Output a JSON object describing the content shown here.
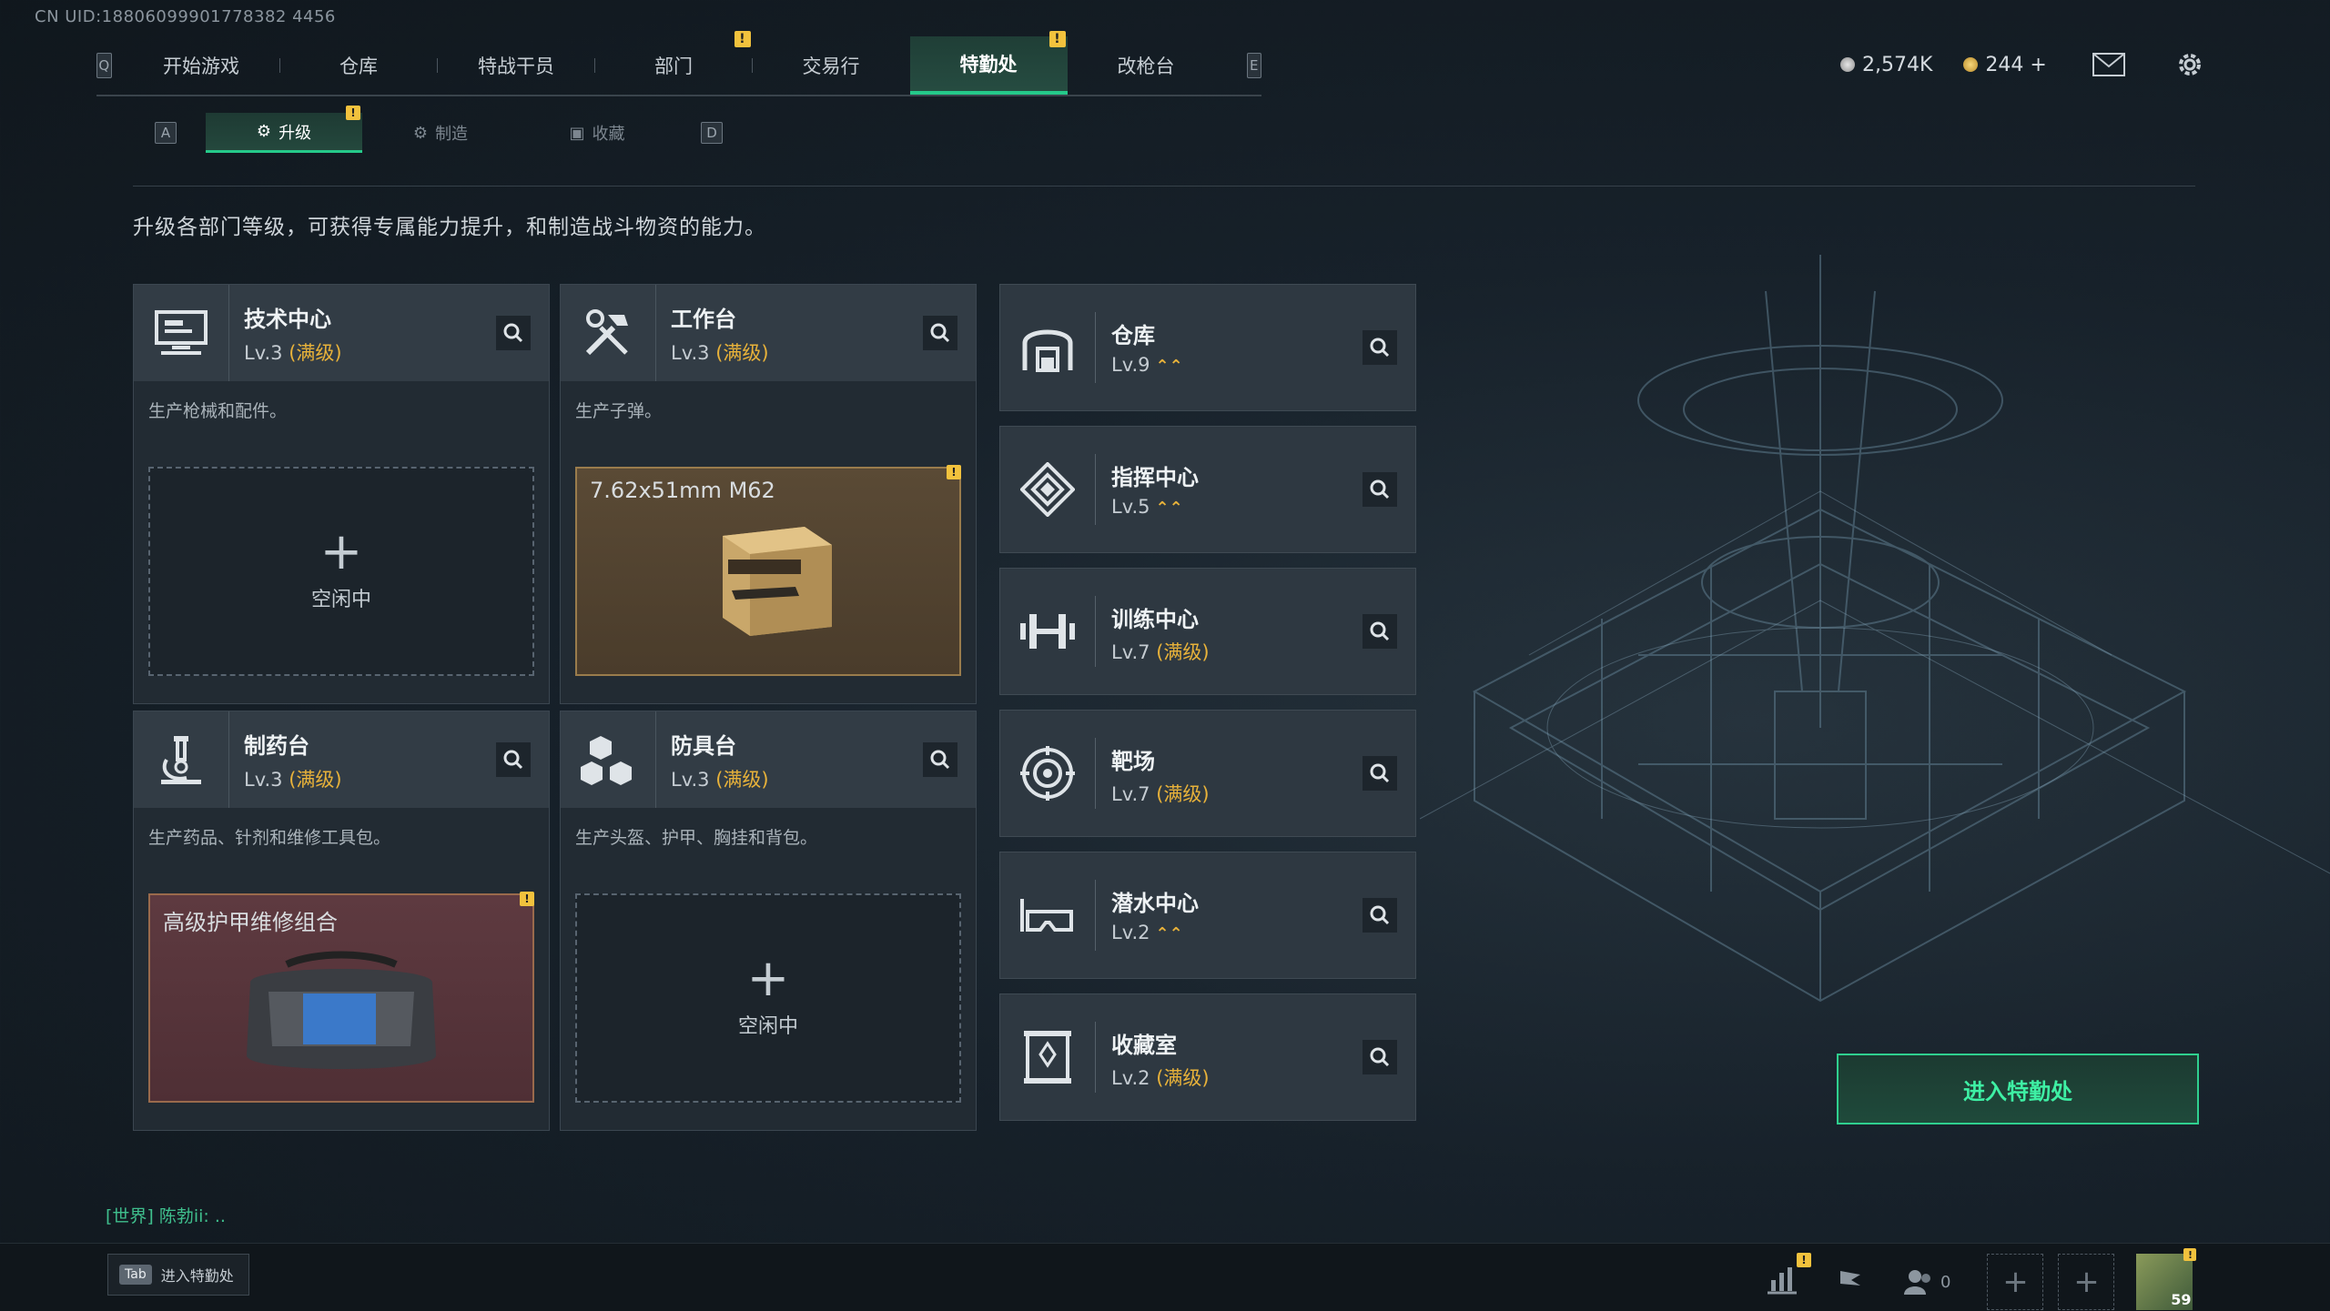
{
  "header": {
    "uid": "CN UID:18806099901778382 4456",
    "nav_left_key": "Q",
    "nav_right_key": "E",
    "nav_items": [
      {
        "label": "开始游戏",
        "badge": ""
      },
      {
        "label": "仓库",
        "badge": ""
      },
      {
        "label": "特战干员",
        "badge": ""
      },
      {
        "label": "部门",
        "badge": "!"
      },
      {
        "label": "交易行",
        "badge": ""
      },
      {
        "label": "特勤处",
        "badge": "!"
      },
      {
        "label": "改枪台",
        "badge": ""
      }
    ],
    "currency_1": "2,574K",
    "currency_2": "244 +"
  },
  "subtabs": {
    "left_key": "A",
    "right_key": "D",
    "items": [
      {
        "label": "升级",
        "badge": "!"
      },
      {
        "label": "制造",
        "badge": ""
      },
      {
        "label": "收藏",
        "badge": ""
      }
    ]
  },
  "description": "升级各部门等级，可获得专属能力提升，和制造战斗物资的能力。",
  "big_cards": [
    {
      "name": "技术中心",
      "level": "Lv.3",
      "maxed": "(满级)",
      "desc": "生产枪械和配件。",
      "slot": {
        "state": "idle",
        "idle_label": "空闲中"
      },
      "icon": "monitor-icon"
    },
    {
      "name": "工作台",
      "level": "Lv.3",
      "maxed": "(满级)",
      "desc": "生产子弹。",
      "slot": {
        "state": "item",
        "item_label": "7.62x51mm M62",
        "badge": "!"
      },
      "icon": "tools-icon"
    },
    {
      "name": "制药台",
      "level": "Lv.3",
      "maxed": "(满级)",
      "desc": "生产药品、针剂和维修工具包。",
      "slot": {
        "state": "item",
        "item_label": "高级护甲维修组合",
        "badge": "!"
      },
      "icon": "microscope-icon"
    },
    {
      "name": "防具台",
      "level": "Lv.3",
      "maxed": "(满级)",
      "desc": "生产头盔、护甲、胸挂和背包。",
      "slot": {
        "state": "idle",
        "idle_label": "空闲中"
      },
      "icon": "cubes-icon"
    }
  ],
  "small_cards": [
    {
      "name": "仓库",
      "level": "Lv.9",
      "maxed": "",
      "upgradable": true,
      "icon": "warehouse-icon"
    },
    {
      "name": "指挥中心",
      "level": "Lv.5",
      "maxed": "",
      "upgradable": true,
      "icon": "command-icon"
    },
    {
      "name": "训练中心",
      "level": "Lv.7",
      "maxed": "(满级)",
      "upgradable": false,
      "icon": "dumbbell-icon"
    },
    {
      "name": "靶场",
      "level": "Lv.7",
      "maxed": "(满级)",
      "upgradable": false,
      "icon": "target-icon"
    },
    {
      "name": "潜水中心",
      "level": "Lv.2",
      "maxed": "",
      "upgradable": true,
      "icon": "goggles-icon"
    },
    {
      "name": "收藏室",
      "level": "Lv.2",
      "maxed": "(满级)",
      "upgradable": false,
      "icon": "trophy-icon"
    }
  ],
  "enter_button": "进入特勤处",
  "chat": "[世界] 陈勃ii: ..",
  "tab_hint": {
    "key": "Tab",
    "label": "进入特勤处"
  },
  "bottom": {
    "friends_count": "0",
    "avatar_level": "59"
  },
  "colors": {
    "accent": "#25c98a",
    "maxed": "#e8b23a",
    "badge": "#f2c23d"
  }
}
